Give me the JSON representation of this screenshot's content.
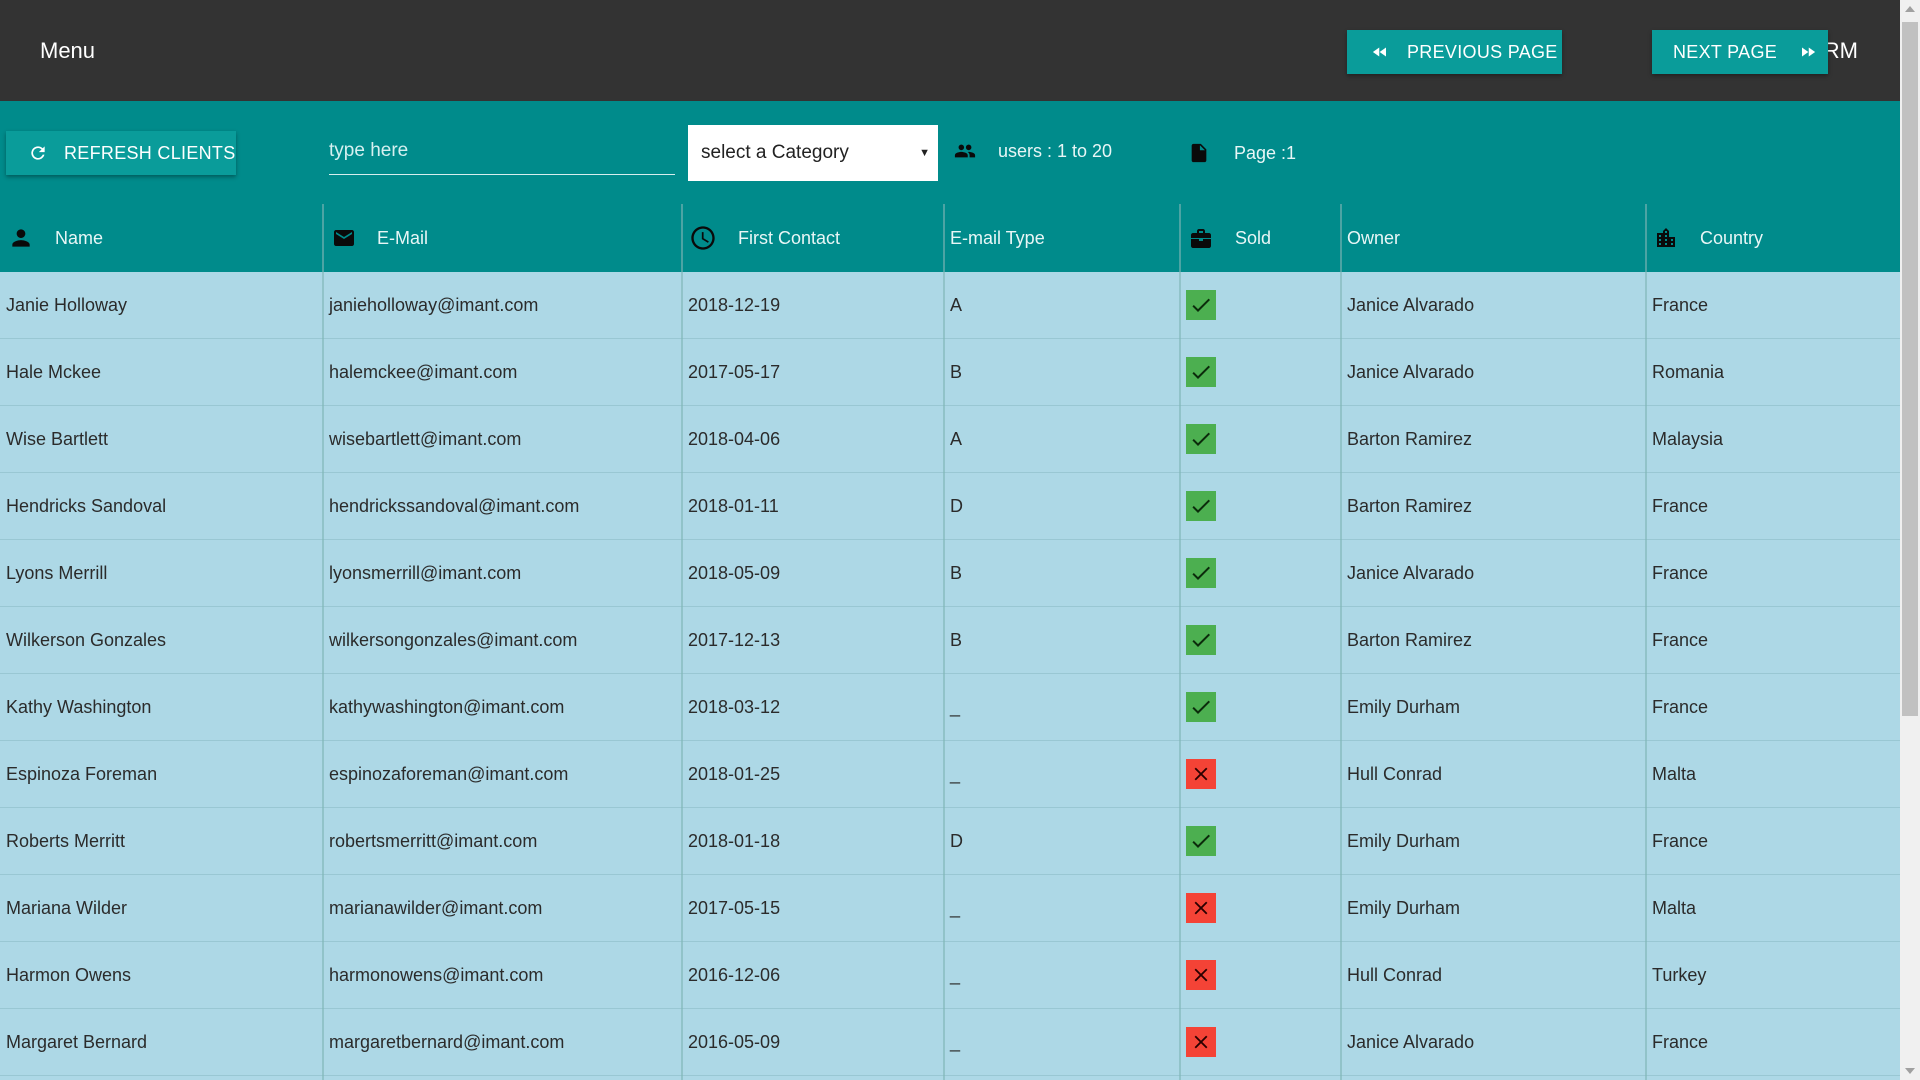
{
  "topbar": {
    "menu_label": "Menu",
    "brand": "CRM"
  },
  "toolbar": {
    "refresh_label": "REFRESH CLIENTS",
    "search_placeholder": "type here",
    "category_value": "select a Category",
    "users_range": "users : 1 to 20",
    "page_label": "Page :1",
    "prev_label": "PREVIOUS PAGE",
    "next_label": "NEXT PAGE"
  },
  "columns": {
    "name": "Name",
    "email": "E-Mail",
    "first_contact": "First Contact",
    "email_type": "E-mail Type",
    "sold": "Sold",
    "owner": "Owner",
    "country": "Country"
  },
  "colors": {
    "topbar": "#333333",
    "teal": "#008b8b",
    "row_bg": "#add8e6",
    "sold_yes": "#4caf50",
    "sold_no": "#f44336"
  },
  "rows": [
    {
      "name": "Janie Holloway",
      "email": "janieholloway@imant.com",
      "first_contact": "2018-12-19",
      "email_type": "A",
      "sold": true,
      "owner": "Janice Alvarado",
      "country": "France"
    },
    {
      "name": "Hale Mckee",
      "email": "halemckee@imant.com",
      "first_contact": "2017-05-17",
      "email_type": "B",
      "sold": true,
      "owner": "Janice Alvarado",
      "country": "Romania"
    },
    {
      "name": "Wise Bartlett",
      "email": "wisebartlett@imant.com",
      "first_contact": "2018-04-06",
      "email_type": "A",
      "sold": true,
      "owner": "Barton Ramirez",
      "country": "Malaysia"
    },
    {
      "name": "Hendricks Sandoval",
      "email": "hendrickssandoval@imant.com",
      "first_contact": "2018-01-11",
      "email_type": "D",
      "sold": true,
      "owner": "Barton Ramirez",
      "country": "France"
    },
    {
      "name": "Lyons Merrill",
      "email": "lyonsmerrill@imant.com",
      "first_contact": "2018-05-09",
      "email_type": "B",
      "sold": true,
      "owner": "Janice Alvarado",
      "country": "France"
    },
    {
      "name": "Wilkerson Gonzales",
      "email": "wilkersongonzales@imant.com",
      "first_contact": "2017-12-13",
      "email_type": "B",
      "sold": true,
      "owner": "Barton Ramirez",
      "country": "France"
    },
    {
      "name": "Kathy Washington",
      "email": "kathywashington@imant.com",
      "first_contact": "2018-03-12",
      "email_type": "_",
      "sold": true,
      "owner": "Emily Durham",
      "country": "France"
    },
    {
      "name": "Espinoza Foreman",
      "email": "espinozaforeman@imant.com",
      "first_contact": "2018-01-25",
      "email_type": "_",
      "sold": false,
      "owner": "Hull Conrad",
      "country": "Malta"
    },
    {
      "name": "Roberts Merritt",
      "email": "robertsmerritt@imant.com",
      "first_contact": "2018-01-18",
      "email_type": "D",
      "sold": true,
      "owner": "Emily Durham",
      "country": "France"
    },
    {
      "name": "Mariana Wilder",
      "email": "marianawilder@imant.com",
      "first_contact": "2017-05-15",
      "email_type": "_",
      "sold": false,
      "owner": "Emily Durham",
      "country": "Malta"
    },
    {
      "name": "Harmon Owens",
      "email": "harmonowens@imant.com",
      "first_contact": "2016-12-06",
      "email_type": "_",
      "sold": false,
      "owner": "Hull Conrad",
      "country": "Turkey"
    },
    {
      "name": "Margaret Bernard",
      "email": "margaretbernard@imant.com",
      "first_contact": "2016-05-09",
      "email_type": "_",
      "sold": false,
      "owner": "Janice Alvarado",
      "country": "France"
    }
  ]
}
